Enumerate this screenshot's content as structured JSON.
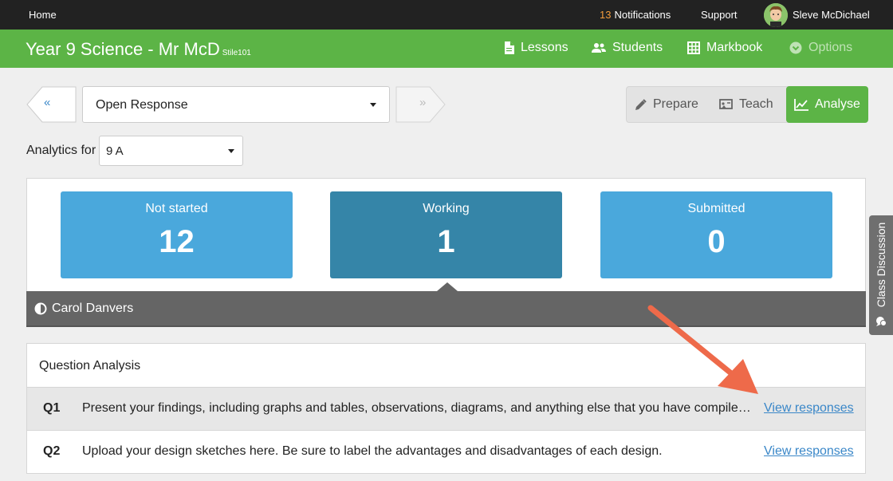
{
  "topbar": {
    "home": "Home",
    "notifications_count": "13",
    "notifications_label": "Notifications",
    "support": "Support",
    "user_name": "Sleve McDichael"
  },
  "header": {
    "title": "Year 9 Science - Mr McD",
    "code": "Stile101",
    "nav": {
      "lessons": "Lessons",
      "students": "Students",
      "markbook": "Markbook",
      "options": "Options"
    }
  },
  "controls": {
    "prev_label": "«",
    "next_label": "»",
    "lesson_select_value": "Open Response",
    "modes": {
      "prepare": "Prepare",
      "teach": "Teach",
      "analyse": "Analyse"
    },
    "active_mode": "analyse",
    "analytics_label": "Analytics for",
    "class_select_value": "9 A"
  },
  "stats": {
    "not_started": {
      "label": "Not started",
      "value": "12"
    },
    "working": {
      "label": "Working",
      "value": "1"
    },
    "submitted": {
      "label": "Submitted",
      "value": "0"
    },
    "selected": "working",
    "student_name": "Carol Danvers"
  },
  "question_analysis": {
    "title": "Question Analysis",
    "questions": [
      {
        "number": "Q1",
        "text": "Present your findings, including graphs and tables, observations, diagrams, and anything else that you have compiled during your investigation.",
        "link": "View responses"
      },
      {
        "number": "Q2",
        "text": "Upload your design sketches here. Be sure to label the advantages and disadvantages of each design.",
        "link": "View responses"
      }
    ]
  },
  "side_tab": {
    "label": "Class Discussion"
  },
  "colors": {
    "brand_green": "#5cb446",
    "card_blue": "#4aa8dc",
    "card_active": "#3585a8",
    "annotation_arrow": "#ee6a4a",
    "link_blue": "#3a87c8",
    "notif_orange": "#f39c3c"
  }
}
